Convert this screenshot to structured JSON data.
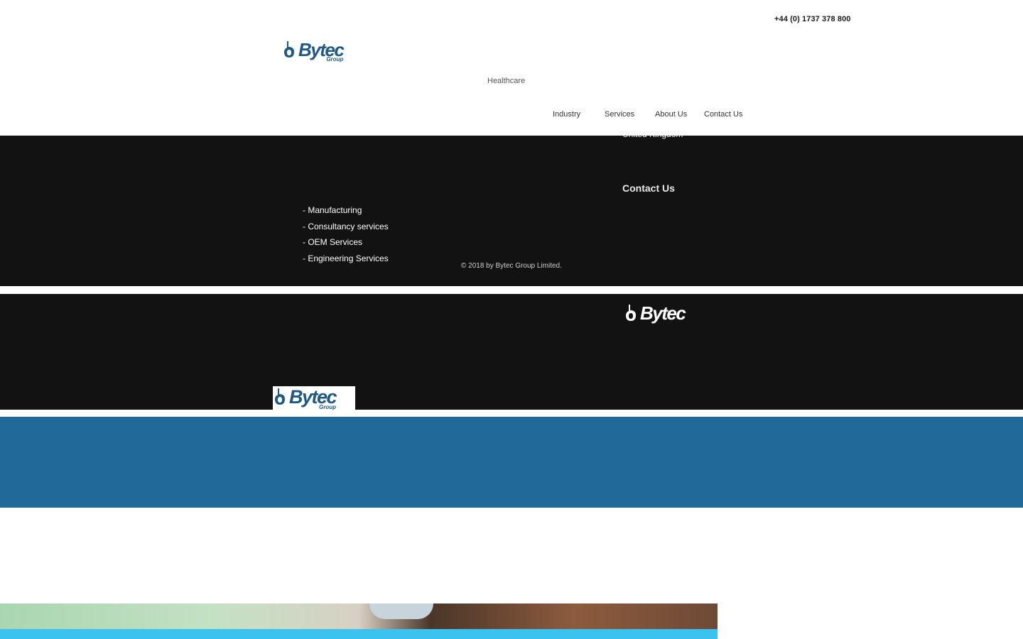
{
  "header": {
    "phone": "+44 (0) 1737 378 800",
    "logo": {
      "word": "Bytec",
      "sub": "Group",
      "color": "#1e5a84"
    },
    "top_link": "Healthcare",
    "nav": [
      "Industry",
      "Services",
      "About Us",
      "Contact Us"
    ]
  },
  "footer": {
    "address_line": "United Kingdom",
    "contact_heading": "Contact Us",
    "services": [
      "- Manufacturing",
      "- Consultancy services",
      "- OEM Services",
      "- Engineering Services"
    ],
    "copyright": "© 2018 by Bytec Group Limited."
  },
  "footer2": {
    "white_logo": {
      "word": "Bytec"
    },
    "blue_logo": {
      "word": "Bytec",
      "sub": "Group"
    }
  },
  "colors": {
    "dark_band": "#121212",
    "blue_band": "#206a9a",
    "accent": "#3cc2ee",
    "logo_blue": "#1e5a84"
  }
}
